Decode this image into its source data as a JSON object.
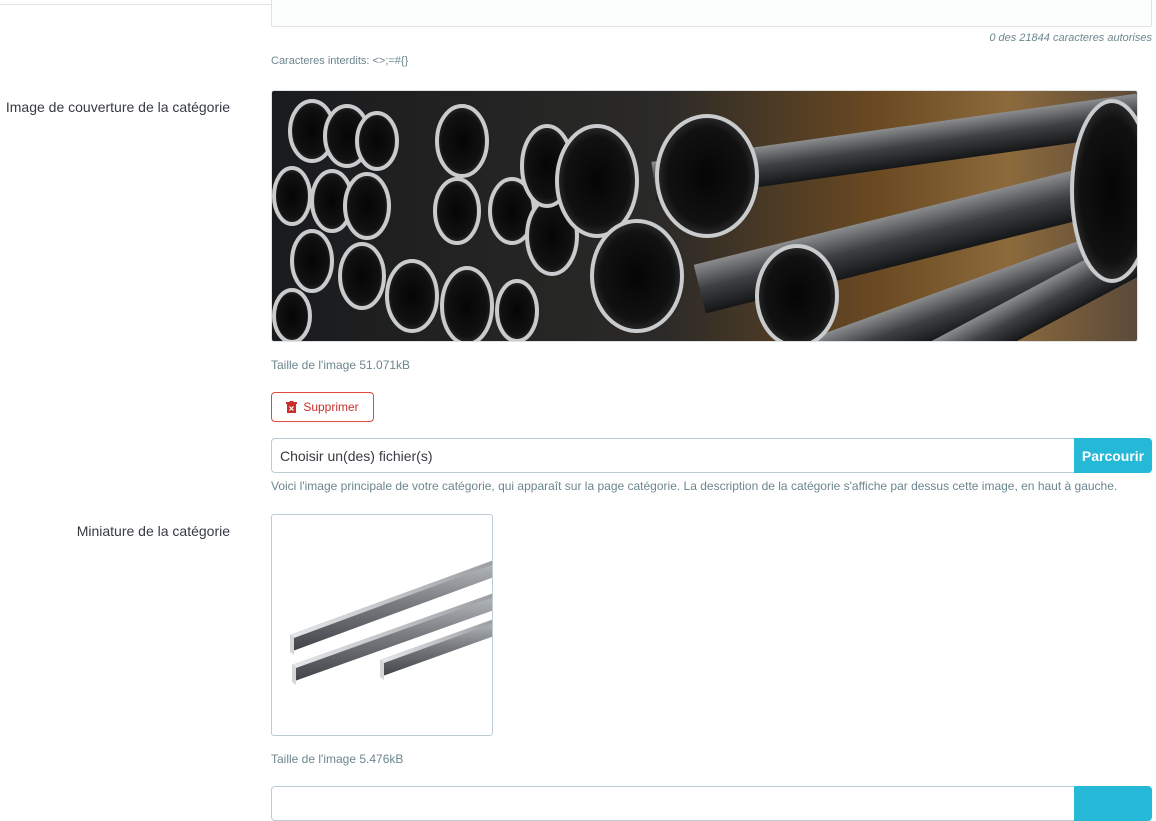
{
  "description_field": {
    "char_counter": "0 des 21844 caracteres autorises",
    "forbidden_chars": "Caracteres interdits: <>;=#{}"
  },
  "cover": {
    "label": "Image de couverture de la catégorie",
    "image_alt": "steel-tubes-photo",
    "size_text": "Taille de l'image 51.071kB",
    "delete_label": "Supprimer",
    "file_placeholder": "Choisir un(des) fichier(s)",
    "browse_label": "Parcourir",
    "help": "Voici l'image principale de votre catégorie, qui apparaît sur la page catégorie. La description de la catégorie s'affiche par dessus cette image, en haut à gauche."
  },
  "thumbnail": {
    "label": "Miniature de la catégorie",
    "image_alt": "steel-flat-bars-photo",
    "size_text": "Taille de l'image 5.476kB"
  },
  "colors": {
    "accent": "#25b9d7",
    "danger": "#e14a3b",
    "muted_text": "#6c868e"
  },
  "icons": {
    "delete": "trash-icon"
  }
}
